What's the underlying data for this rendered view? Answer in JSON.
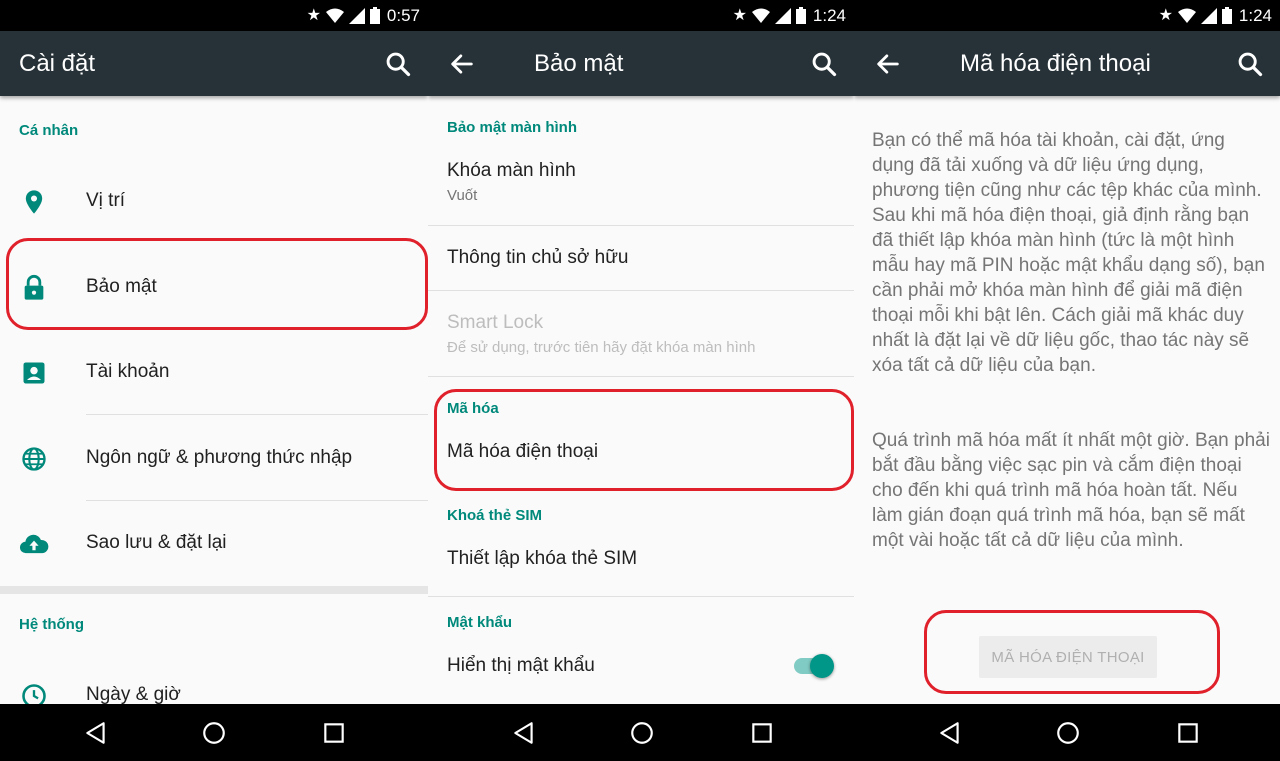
{
  "colors": {
    "accent": "#00897b",
    "appbar": "#263238",
    "highlight": "#e0202a"
  },
  "panel1": {
    "status_time": "0:57",
    "title": "Cài đặt",
    "section_personal": "Cá nhân",
    "items": [
      {
        "label": "Vị trí",
        "icon": "location-pin-icon"
      },
      {
        "label": "Bảo mật",
        "icon": "lock-icon"
      },
      {
        "label": "Tài khoản",
        "icon": "account-icon"
      },
      {
        "label": "Ngôn ngữ & phương thức nhập",
        "icon": "globe-icon"
      },
      {
        "label": "Sao lưu & đặt lại",
        "icon": "cloud-upload-icon"
      }
    ],
    "section_system": "Hệ thống",
    "system_items": [
      {
        "label": "Ngày & giờ",
        "icon": "clock-icon"
      }
    ]
  },
  "panel2": {
    "status_time": "1:24",
    "title": "Bảo mật",
    "section_screen": "Bảo mật màn hình",
    "lock_screen": {
      "title": "Khóa màn hình",
      "subtitle": "Vuốt"
    },
    "owner_info": "Thông tin chủ sở hữu",
    "smart_lock": {
      "title": "Smart Lock",
      "subtitle": "Để sử dụng, trước tiên hãy đặt khóa màn hình"
    },
    "section_encryption": "Mã hóa",
    "encrypt_phone": "Mã hóa điện thoại",
    "section_sim": "Khoá thẻ SIM",
    "sim_lock": "Thiết lập khóa thẻ SIM",
    "section_password": "Mật khẩu",
    "show_password": "Hiển thị mật khẩu",
    "show_password_on": true
  },
  "panel3": {
    "status_time": "1:24",
    "title": "Mã hóa điện thoại",
    "paragraph1": "Bạn có thể mã hóa tài khoản, cài đặt, ứng dụng đã tải xuống và dữ liệu ứng dụng, phương tiện cũng như các tệp khác của mình. Sau khi mã hóa điện thoại, giả định rằng bạn đã thiết lập khóa màn hình (tức là một hình mẫu hay mã PIN hoặc mật khẩu dạng số), bạn cần phải mở khóa màn hình để giải mã điện thoại mỗi khi bật lên. Cách giải mã khác duy nhất là đặt lại về dữ liệu gốc, thao tác này sẽ xóa tất cả dữ liệu của bạn.",
    "paragraph2": "Quá trình mã hóa mất ít nhất một giờ. Bạn phải bắt đầu bằng việc sạc pin và cắm điện thoại cho đến khi quá trình mã hóa hoàn tất. Nếu làm gián đoạn quá trình mã hóa, bạn sẽ mất một vài hoặc tất cả dữ liệu của mình.",
    "button": "MÃ HÓA ĐIỆN THOẠI"
  }
}
